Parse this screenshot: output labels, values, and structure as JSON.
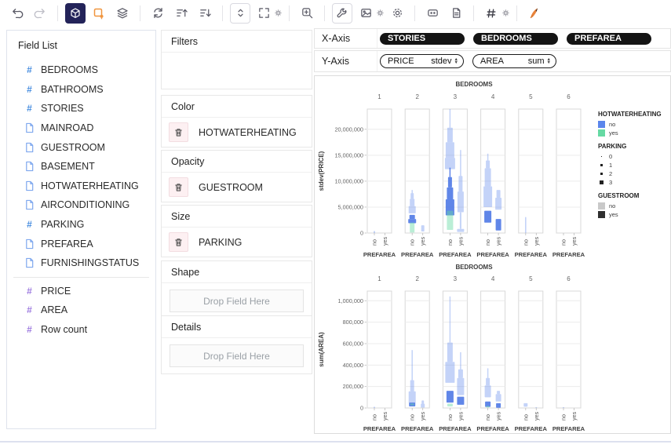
{
  "toolbar": {
    "icons": [
      "undo",
      "redo",
      "cube-view",
      "add-annotation",
      "layers",
      "refresh",
      "sort-ascending",
      "sort-descending",
      "fit-vertical",
      "expand-settings",
      "zoom-area",
      "wrench-tools",
      "image-settings",
      "settings",
      "code-values",
      "document",
      "number-format",
      "theme-brush"
    ]
  },
  "field_list": {
    "title": "Field List",
    "items": [
      {
        "label": "BEDROOMS",
        "icon": "hash-blue"
      },
      {
        "label": "BATHROOMS",
        "icon": "hash-blue"
      },
      {
        "label": "STORIES",
        "icon": "hash-blue"
      },
      {
        "label": "MAINROAD",
        "icon": "doc"
      },
      {
        "label": "GUESTROOM",
        "icon": "doc"
      },
      {
        "label": "BASEMENT",
        "icon": "doc"
      },
      {
        "label": "HOTWATERHEATING",
        "icon": "doc"
      },
      {
        "label": "AIRCONDITIONING",
        "icon": "doc"
      },
      {
        "label": "PARKING",
        "icon": "hash-blue"
      },
      {
        "label": "PREFAREA",
        "icon": "doc"
      },
      {
        "label": "FURNISHINGSTATUS",
        "icon": "doc",
        "divider_after": true
      },
      {
        "label": "PRICE",
        "icon": "hash-purple"
      },
      {
        "label": "AREA",
        "icon": "hash-purple"
      },
      {
        "label": "Row count",
        "icon": "hash-purple"
      }
    ]
  },
  "encodings": {
    "sections": [
      {
        "label": "Filters",
        "field": null
      },
      {
        "label": "Color",
        "field": "HOTWATERHEATING"
      },
      {
        "label": "Opacity",
        "field": "GUESTROOM"
      },
      {
        "label": "Size",
        "field": "PARKING"
      },
      {
        "label": "Shape",
        "field": null,
        "placeholder": "Drop Field Here"
      },
      {
        "label": "Details",
        "field": null,
        "placeholder": "Drop Field Here"
      }
    ]
  },
  "axes": {
    "x_title": "X-Axis",
    "y_title": "Y-Axis",
    "x_fields": [
      "STORIES",
      "BEDROOMS",
      "PREFAREA"
    ],
    "y_fields": [
      {
        "field": "PRICE",
        "agg": "stdev"
      },
      {
        "field": "AREA",
        "agg": "sum"
      }
    ]
  },
  "legend": {
    "groups": [
      {
        "title": "HOTWATERHEATING",
        "type": "color",
        "entries": [
          {
            "label": "no",
            "color": "#5B86EC"
          },
          {
            "label": "yes",
            "color": "#66D9A3"
          }
        ]
      },
      {
        "title": "PARKING",
        "type": "size",
        "entries": [
          {
            "label": "0",
            "size": 1.5
          },
          {
            "label": "1",
            "size": 2.5
          },
          {
            "label": "2",
            "size": 3.5
          },
          {
            "label": "3",
            "size": 4.5
          }
        ]
      },
      {
        "title": "GUESTROOM",
        "type": "color",
        "entries": [
          {
            "label": "no",
            "color": "#C9C9C9"
          },
          {
            "label": "yes",
            "color": "#2F2F2F"
          }
        ]
      }
    ]
  },
  "colors": {
    "mark_blue": "#5B86EC",
    "mark_green": "#66D9A3",
    "pill_black": "#141414",
    "accent_navy": "#232359",
    "accent_orange": "#F0953F"
  },
  "mark_styles": {
    "lb": {
      "color": "#5B86EC",
      "opacity": 0.36,
      "meaning": "HOTWATERHEATING=no, GUESTROOM=no"
    },
    "b": {
      "color": "#4f79e6",
      "opacity": 0.9,
      "meaning": "HOTWATERHEATING=no, GUESTROOM=yes"
    },
    "g": {
      "color": "#66D9A3",
      "opacity": 0.45,
      "meaning": "HOTWATERHEATING=yes"
    }
  },
  "chart_data": [
    {
      "type": "scatter",
      "subtype": "graduated-symbol strip plot, faceted",
      "title": "BEDROOMS",
      "facet_field": "BEDROOMS",
      "facets": [
        "1",
        "2",
        "3",
        "4",
        "5",
        "6"
      ],
      "x_field": "PREFAREA",
      "categories": [
        "no",
        "yes"
      ],
      "ylabel": "stdev(PRICE)",
      "ylim": [
        0,
        23900000
      ],
      "grid": true,
      "legend_position": "right",
      "yticks": [
        {
          "v": 0,
          "label": "0"
        },
        {
          "v": 5000000,
          "label": "5,000,000"
        },
        {
          "v": 10000000,
          "label": "10,000,000"
        },
        {
          "v": 15000000,
          "label": "15,000,000"
        },
        {
          "v": 20000000,
          "label": "20,000,000"
        }
      ],
      "marks": [
        {
          "f": 1,
          "x": "no",
          "c": "lb",
          "segs": [
            [
              0,
              400000,
              2
            ]
          ]
        },
        {
          "f": 2,
          "x": "no",
          "c": "lb",
          "segs": [
            [
              3800000,
              5200000,
              9
            ],
            [
              5200000,
              6600000,
              6
            ],
            [
              6600000,
              7700000,
              4
            ]
          ],
          "tail": [
            7700000,
            8300000
          ]
        },
        {
          "f": 2,
          "x": "no",
          "c": "b",
          "segs": [
            [
              1900000,
              2700000,
              10
            ],
            [
              2700000,
              3500000,
              7
            ]
          ]
        },
        {
          "f": 2,
          "x": "no",
          "c": "g",
          "segs": [
            [
              100000,
              2000000,
              6
            ]
          ]
        },
        {
          "f": 2,
          "x": "yes",
          "c": "lb",
          "segs": [
            [
              300000,
              1500000,
              4
            ]
          ]
        },
        {
          "f": 3,
          "x": "no",
          "c": "lb",
          "segs": [
            [
              12300000,
              14500000,
              13
            ],
            [
              14500000,
              17500000,
              11
            ],
            [
              17500000,
              20300000,
              7
            ]
          ],
          "tail": [
            20300000,
            23900000
          ]
        },
        {
          "f": 3,
          "x": "no",
          "c": "b",
          "segs": [
            [
              3400000,
              6500000,
              11
            ],
            [
              6500000,
              8800000,
              8
            ],
            [
              8800000,
              10800000,
              5
            ]
          ],
          "tail": [
            10800000,
            12600000
          ]
        },
        {
          "f": 3,
          "x": "no",
          "c": "g",
          "segs": [
            [
              600000,
              4300000,
              8
            ]
          ]
        },
        {
          "f": 3,
          "x": "yes",
          "c": "lb",
          "segs": [
            [
              200000,
              800000,
              9
            ],
            [
              800000,
              4000000,
              2
            ],
            [
              4000000,
              8000000,
              8
            ],
            [
              8000000,
              11000000,
              5
            ]
          ],
          "tail": [
            11000000,
            16000000
          ]
        },
        {
          "f": 4,
          "x": "no",
          "c": "lb",
          "segs": [
            [
              5000000,
              9000000,
              11
            ],
            [
              9000000,
              12500000,
              8
            ],
            [
              12500000,
              14000000,
              5
            ]
          ],
          "tail": [
            14000000,
            15300000
          ]
        },
        {
          "f": 4,
          "x": "no",
          "c": "b",
          "segs": [
            [
              2000000,
              4300000,
              9
            ]
          ]
        },
        {
          "f": 4,
          "x": "yes",
          "c": "lb",
          "segs": [
            [
              4500000,
              6800000,
              8
            ],
            [
              6800000,
              8300000,
              5
            ]
          ]
        },
        {
          "f": 4,
          "x": "yes",
          "c": "b",
          "segs": [
            [
              500000,
              2700000,
              7
            ]
          ]
        },
        {
          "f": 5,
          "x": "no",
          "c": "lb",
          "segs": [
            [
              0,
              3100000,
              1.6
            ]
          ]
        }
      ]
    },
    {
      "type": "scatter",
      "subtype": "graduated-symbol strip plot, faceted",
      "title": "BEDROOMS",
      "facet_field": "BEDROOMS",
      "facets": [
        "1",
        "2",
        "3",
        "4",
        "5",
        "6"
      ],
      "x_field": "PREFAREA",
      "categories": [
        "no",
        "yes"
      ],
      "ylabel": "sum(AREA)",
      "ylim": [
        0,
        1090000
      ],
      "grid": true,
      "yticks": [
        {
          "v": 0,
          "label": "0"
        },
        {
          "v": 200000,
          "label": "200,000"
        },
        {
          "v": 400000,
          "label": "400,000"
        },
        {
          "v": 600000,
          "label": "600,000"
        },
        {
          "v": 800000,
          "label": "800,000"
        },
        {
          "v": 1000000,
          "label": "1,000,000"
        }
      ],
      "marks": [
        {
          "f": 1,
          "x": "no",
          "c": "lb",
          "segs": [
            [
              0,
              12000,
              2
            ]
          ]
        },
        {
          "f": 2,
          "x": "no",
          "c": "lb",
          "segs": [
            [
              45000,
              155000,
              9
            ],
            [
              155000,
              260000,
              5
            ]
          ],
          "tail": [
            260000,
            540000
          ]
        },
        {
          "f": 2,
          "x": "no",
          "c": "b",
          "segs": [
            [
              15000,
              50000,
              8
            ]
          ]
        },
        {
          "f": 2,
          "x": "no",
          "c": "g",
          "segs": [
            [
              25000,
              42000,
              5
            ]
          ]
        },
        {
          "f": 2,
          "x": "yes",
          "c": "lb",
          "segs": [
            [
              4000,
              40000,
              5
            ],
            [
              40000,
              70000,
              3
            ]
          ]
        },
        {
          "f": 3,
          "x": "no",
          "c": "lb",
          "segs": [
            [
              235000,
              430000,
              12
            ],
            [
              430000,
              610000,
              7
            ]
          ],
          "tail": [
            610000,
            1040000
          ]
        },
        {
          "f": 3,
          "x": "no",
          "c": "b",
          "segs": [
            [
              50000,
              160000,
              9
            ]
          ]
        },
        {
          "f": 3,
          "x": "no",
          "c": "g",
          "segs": [
            [
              15000,
              40000,
              7
            ]
          ]
        },
        {
          "f": 3,
          "x": "yes",
          "c": "lb",
          "segs": [
            [
              120000,
              280000,
              9
            ],
            [
              280000,
              360000,
              6
            ]
          ],
          "tail": [
            360000,
            520000
          ]
        },
        {
          "f": 3,
          "x": "yes",
          "c": "b",
          "segs": [
            [
              30000,
              105000,
              9
            ]
          ]
        },
        {
          "f": 4,
          "x": "no",
          "c": "lb",
          "segs": [
            [
              100000,
              210000,
              8
            ],
            [
              210000,
              280000,
              5
            ]
          ],
          "tail": [
            280000,
            370000
          ]
        },
        {
          "f": 4,
          "x": "no",
          "c": "b",
          "segs": [
            [
              10000,
              60000,
              7
            ]
          ]
        },
        {
          "f": 4,
          "x": "no",
          "c": "g",
          "segs": [
            [
              5000,
              20000,
              4
            ]
          ]
        },
        {
          "f": 4,
          "x": "yes",
          "c": "lb",
          "segs": [
            [
              60000,
              130000,
              7
            ],
            [
              130000,
              160000,
              4
            ]
          ]
        },
        {
          "f": 4,
          "x": "yes",
          "c": "b",
          "segs": [
            [
              2000,
              45000,
              6
            ]
          ]
        },
        {
          "f": 5,
          "x": "no",
          "c": "lb",
          "segs": [
            [
              12000,
              45000,
              5
            ]
          ]
        },
        {
          "f": 5,
          "x": "yes",
          "c": "lb",
          "segs": [
            [
              0,
              8000,
              2
            ]
          ]
        },
        {
          "f": 6,
          "x": "no",
          "c": "lb",
          "segs": [
            [
              0,
              8000,
              2
            ]
          ]
        }
      ]
    }
  ]
}
